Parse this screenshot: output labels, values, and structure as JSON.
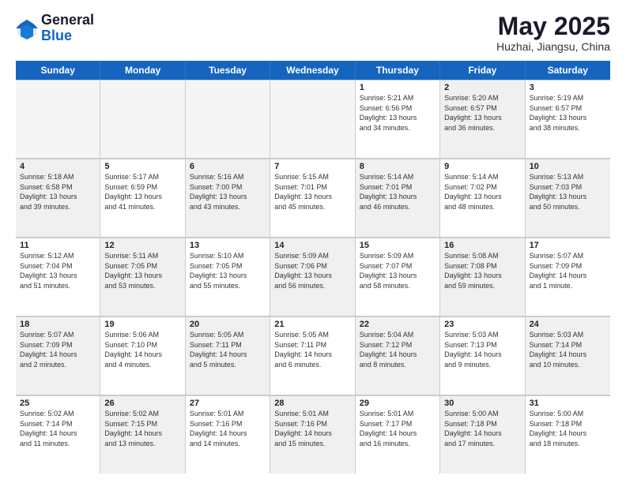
{
  "header": {
    "logo_general": "General",
    "logo_blue": "Blue",
    "month_title": "May 2025",
    "location": "Huzhai, Jiangsu, China"
  },
  "weekdays": [
    "Sunday",
    "Monday",
    "Tuesday",
    "Wednesday",
    "Thursday",
    "Friday",
    "Saturday"
  ],
  "rows": [
    [
      {
        "day": "",
        "text": "",
        "empty": true
      },
      {
        "day": "",
        "text": "",
        "empty": true
      },
      {
        "day": "",
        "text": "",
        "empty": true
      },
      {
        "day": "",
        "text": "",
        "empty": true
      },
      {
        "day": "1",
        "text": "Sunrise: 5:21 AM\nSunset: 6:56 PM\nDaylight: 13 hours\nand 34 minutes."
      },
      {
        "day": "2",
        "text": "Sunrise: 5:20 AM\nSunset: 6:57 PM\nDaylight: 13 hours\nand 36 minutes.",
        "shaded": true
      },
      {
        "day": "3",
        "text": "Sunrise: 5:19 AM\nSunset: 6:57 PM\nDaylight: 13 hours\nand 38 minutes."
      }
    ],
    [
      {
        "day": "4",
        "text": "Sunrise: 5:18 AM\nSunset: 6:58 PM\nDaylight: 13 hours\nand 39 minutes.",
        "shaded": true
      },
      {
        "day": "5",
        "text": "Sunrise: 5:17 AM\nSunset: 6:59 PM\nDaylight: 13 hours\nand 41 minutes."
      },
      {
        "day": "6",
        "text": "Sunrise: 5:16 AM\nSunset: 7:00 PM\nDaylight: 13 hours\nand 43 minutes.",
        "shaded": true
      },
      {
        "day": "7",
        "text": "Sunrise: 5:15 AM\nSunset: 7:01 PM\nDaylight: 13 hours\nand 45 minutes."
      },
      {
        "day": "8",
        "text": "Sunrise: 5:14 AM\nSunset: 7:01 PM\nDaylight: 13 hours\nand 46 minutes.",
        "shaded": true
      },
      {
        "day": "9",
        "text": "Sunrise: 5:14 AM\nSunset: 7:02 PM\nDaylight: 13 hours\nand 48 minutes."
      },
      {
        "day": "10",
        "text": "Sunrise: 5:13 AM\nSunset: 7:03 PM\nDaylight: 13 hours\nand 50 minutes.",
        "shaded": true
      }
    ],
    [
      {
        "day": "11",
        "text": "Sunrise: 5:12 AM\nSunset: 7:04 PM\nDaylight: 13 hours\nand 51 minutes."
      },
      {
        "day": "12",
        "text": "Sunrise: 5:11 AM\nSunset: 7:05 PM\nDaylight: 13 hours\nand 53 minutes.",
        "shaded": true
      },
      {
        "day": "13",
        "text": "Sunrise: 5:10 AM\nSunset: 7:05 PM\nDaylight: 13 hours\nand 55 minutes."
      },
      {
        "day": "14",
        "text": "Sunrise: 5:09 AM\nSunset: 7:06 PM\nDaylight: 13 hours\nand 56 minutes.",
        "shaded": true
      },
      {
        "day": "15",
        "text": "Sunrise: 5:09 AM\nSunset: 7:07 PM\nDaylight: 13 hours\nand 58 minutes."
      },
      {
        "day": "16",
        "text": "Sunrise: 5:08 AM\nSunset: 7:08 PM\nDaylight: 13 hours\nand 59 minutes.",
        "shaded": true
      },
      {
        "day": "17",
        "text": "Sunrise: 5:07 AM\nSunset: 7:09 PM\nDaylight: 14 hours\nand 1 minute."
      }
    ],
    [
      {
        "day": "18",
        "text": "Sunrise: 5:07 AM\nSunset: 7:09 PM\nDaylight: 14 hours\nand 2 minutes.",
        "shaded": true
      },
      {
        "day": "19",
        "text": "Sunrise: 5:06 AM\nSunset: 7:10 PM\nDaylight: 14 hours\nand 4 minutes."
      },
      {
        "day": "20",
        "text": "Sunrise: 5:05 AM\nSunset: 7:11 PM\nDaylight: 14 hours\nand 5 minutes.",
        "shaded": true
      },
      {
        "day": "21",
        "text": "Sunrise: 5:05 AM\nSunset: 7:11 PM\nDaylight: 14 hours\nand 6 minutes."
      },
      {
        "day": "22",
        "text": "Sunrise: 5:04 AM\nSunset: 7:12 PM\nDaylight: 14 hours\nand 8 minutes.",
        "shaded": true
      },
      {
        "day": "23",
        "text": "Sunrise: 5:03 AM\nSunset: 7:13 PM\nDaylight: 14 hours\nand 9 minutes."
      },
      {
        "day": "24",
        "text": "Sunrise: 5:03 AM\nSunset: 7:14 PM\nDaylight: 14 hours\nand 10 minutes.",
        "shaded": true
      }
    ],
    [
      {
        "day": "25",
        "text": "Sunrise: 5:02 AM\nSunset: 7:14 PM\nDaylight: 14 hours\nand 11 minutes."
      },
      {
        "day": "26",
        "text": "Sunrise: 5:02 AM\nSunset: 7:15 PM\nDaylight: 14 hours\nand 13 minutes.",
        "shaded": true
      },
      {
        "day": "27",
        "text": "Sunrise: 5:01 AM\nSunset: 7:16 PM\nDaylight: 14 hours\nand 14 minutes."
      },
      {
        "day": "28",
        "text": "Sunrise: 5:01 AM\nSunset: 7:16 PM\nDaylight: 14 hours\nand 15 minutes.",
        "shaded": true
      },
      {
        "day": "29",
        "text": "Sunrise: 5:01 AM\nSunset: 7:17 PM\nDaylight: 14 hours\nand 16 minutes."
      },
      {
        "day": "30",
        "text": "Sunrise: 5:00 AM\nSunset: 7:18 PM\nDaylight: 14 hours\nand 17 minutes.",
        "shaded": true
      },
      {
        "day": "31",
        "text": "Sunrise: 5:00 AM\nSunset: 7:18 PM\nDaylight: 14 hours\nand 18 minutes."
      }
    ]
  ]
}
